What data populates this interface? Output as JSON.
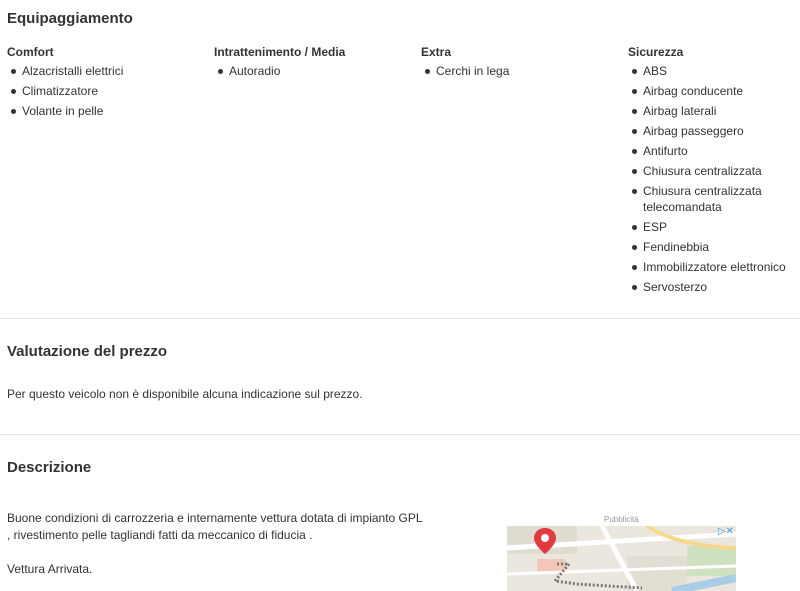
{
  "equipment": {
    "title": "Equipaggiamento",
    "columns": [
      {
        "title": "Comfort",
        "items": [
          "Alzacristalli elettrici",
          "Climatizzatore",
          "Volante in pelle"
        ]
      },
      {
        "title": "Intrattenimento / Media",
        "items": [
          "Autoradio"
        ]
      },
      {
        "title": "Extra",
        "items": [
          "Cerchi in lega"
        ]
      },
      {
        "title": "Sicurezza",
        "items": [
          "ABS",
          "Airbag conducente",
          "Airbag laterali",
          "Airbag passeggero",
          "Antifurto",
          "Chiusura centralizzata",
          "Chiusura centralizzata telecomandata",
          "ESP",
          "Fendinebbia",
          "Immobilizzatore elettronico",
          "Servosterzo"
        ]
      }
    ]
  },
  "price": {
    "title": "Valutazione del prezzo",
    "text": "Per questo veicolo non è disponibile alcuna indicazione sul prezzo."
  },
  "description": {
    "title": "Descrizione",
    "line1": "Buone condizioni di carrozzeria e internamente vettura dotata di impianto GPL",
    "line2": ", rivestimento pelle tagliandi fatti da meccanico di fiducia .",
    "line3": "Vettura Arrivata."
  },
  "ad": {
    "label": "Pubblicità",
    "icon": "map-pin-icon",
    "pin_color": "#e0393e",
    "close_color": "#3ea0d8"
  }
}
